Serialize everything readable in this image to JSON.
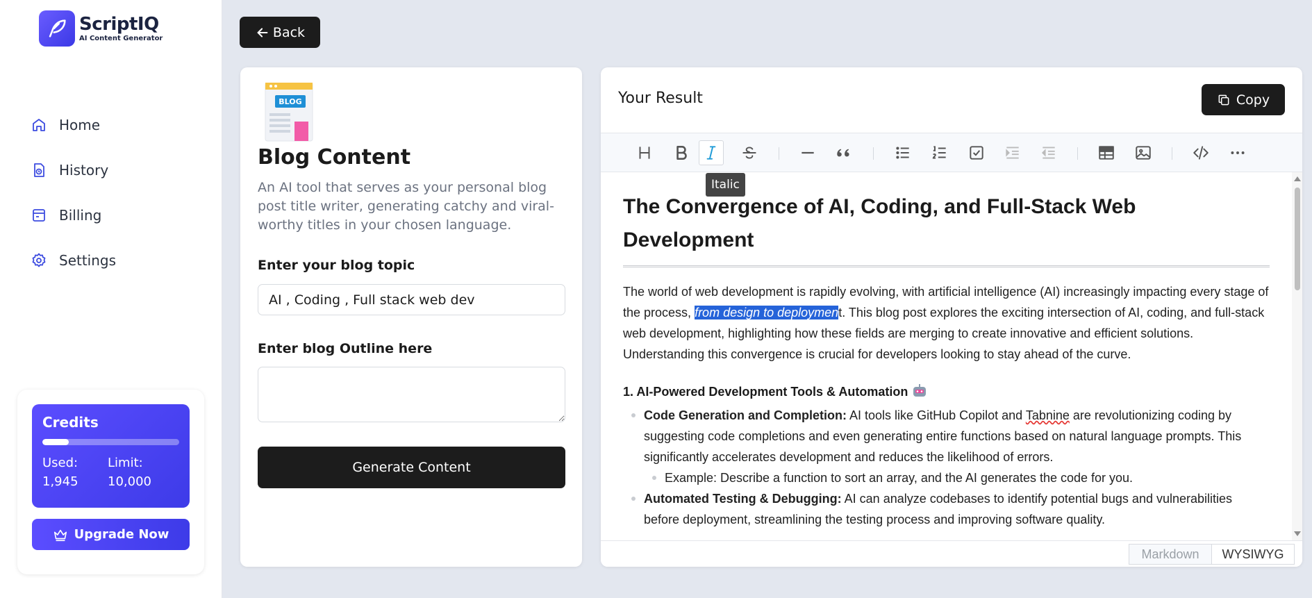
{
  "brand": {
    "name": "ScriptIQ",
    "tagline": "AI Content Generator"
  },
  "nav": {
    "items": [
      {
        "label": "Home",
        "icon": "home-icon"
      },
      {
        "label": "History",
        "icon": "history-icon"
      },
      {
        "label": "Billing",
        "icon": "billing-icon"
      },
      {
        "label": "Settings",
        "icon": "gear-icon"
      }
    ]
  },
  "credits": {
    "title": "Credits",
    "used_label": "Used:",
    "used_value": "1,945",
    "limit_label": "Limit:",
    "limit_value": "10,000",
    "used_fraction": 0.1945,
    "upgrade_label": "Upgrade Now"
  },
  "back_label": "Back",
  "form": {
    "title": "Blog Content",
    "description": "An AI tool that serves as your personal blog post title writer, generating catchy and viral-worthy titles in your chosen language.",
    "topic_label": "Enter your blog topic",
    "topic_value": "AI , Coding , Full stack web dev",
    "outline_label": "Enter blog Outline here",
    "outline_value": "",
    "generate_label": "Generate Content",
    "blog_badge": "BLOG"
  },
  "result": {
    "title": "Your Result",
    "copy_label": "Copy",
    "tooltip": "Italic",
    "doc": {
      "heading": "The Convergence of AI, Coding, and Full-Stack Web Development",
      "intro_before": "The world of web development is rapidly evolving, with artificial intelligence (AI) increasingly impacting every stage of the process, ",
      "intro_selected": "from design to deploymen",
      "intro_after": "t. This blog post explores the exciting intersection of AI, coding, and full-stack web development, highlighting how these fields are merging to create innovative and efficient solutions.  Understanding this convergence is crucial for developers looking to stay ahead of the curve.",
      "section1_title": "1. AI-Powered Development Tools & Automation",
      "item1_bold": "Code Generation and Completion:",
      "item1_before": " AI tools like GitHub Copilot and ",
      "item1_misspelled": "Tabnine",
      "item1_after": " are revolutionizing coding by suggesting code completions and even generating entire functions based on natural language prompts.  This significantly accelerates development and reduces the likelihood of errors.",
      "item1_sub": "Example:  Describe a function to sort an array, and the AI generates the code for you.",
      "item2_bold": "Automated Testing & Debugging:",
      "item2_text": " AI can analyze codebases to identify potential bugs and vulnerabilities before deployment, streamlining the testing process and improving software quality."
    },
    "modes": {
      "markdown": "Markdown",
      "wysiwyg": "WYSIWYG",
      "active": "WYSIWYG"
    }
  },
  "colors": {
    "accent": "#4a43f0",
    "dark_button": "#1c1c1c",
    "selection": "#2563d9",
    "italic_active": "#1e9bd7"
  }
}
